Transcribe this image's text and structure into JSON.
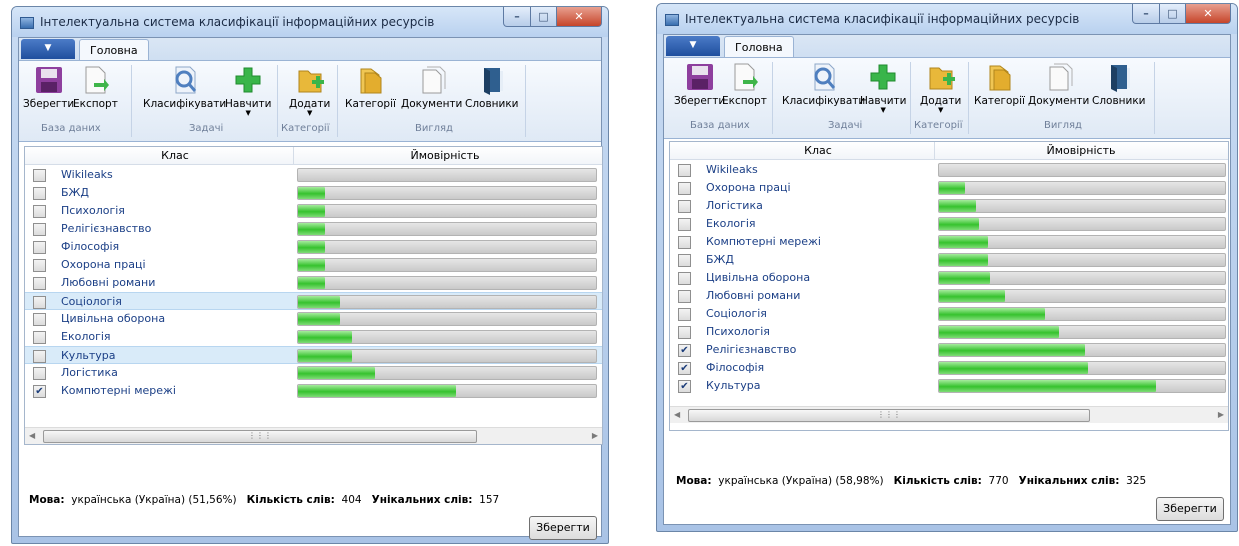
{
  "windows": [
    {
      "title": "Інтелектуальна система класифікації інформаційних ресурсів",
      "tab_home": "Головна",
      "ribbon": {
        "save": "Зберегти",
        "export": "Експорт",
        "classify": "Класифікувати",
        "train": "Навчити",
        "add": "Додати",
        "categories": "Категорії",
        "documents": "Документи",
        "dictionaries": "Словники",
        "group_db": "База даних",
        "group_tasks": "Задачі",
        "group_categories": "Категорії",
        "group_view": "Вигляд"
      },
      "grid": {
        "col_class": "Клас",
        "col_prob": "Ймовірність",
        "rows": [
          {
            "label": "Wikileaks",
            "checked": false,
            "prob": 0.0
          },
          {
            "label": "БЖД",
            "checked": false,
            "prob": 0.09
          },
          {
            "label": "Психологія",
            "checked": false,
            "prob": 0.09
          },
          {
            "label": "Релігієзнавство",
            "checked": false,
            "prob": 0.09
          },
          {
            "label": "Філософія",
            "checked": false,
            "prob": 0.09
          },
          {
            "label": "Охорона праці",
            "checked": false,
            "prob": 0.09
          },
          {
            "label": "Любовні романи",
            "checked": false,
            "prob": 0.09
          },
          {
            "label": "Соціологія",
            "checked": false,
            "prob": 0.14,
            "selected": true
          },
          {
            "label": "Цивільна оборона",
            "checked": false,
            "prob": 0.14
          },
          {
            "label": "Екологія",
            "checked": false,
            "prob": 0.18
          },
          {
            "label": "Культура",
            "checked": false,
            "prob": 0.18,
            "selected": true
          },
          {
            "label": "Логістика",
            "checked": false,
            "prob": 0.26
          },
          {
            "label": "Компютерні мережі",
            "checked": true,
            "prob": 0.53
          }
        ]
      },
      "status": {
        "lang_label": "Мова:",
        "lang_value": "українська (Україна) (51,56%)",
        "words_label": "Кількість слів:",
        "words_value": "404",
        "unique_label": "Унікальних слів:",
        "unique_value": "157"
      },
      "save_button": "Зберегти"
    },
    {
      "title": "Інтелектуальна система класифікації інформаційних ресурсів",
      "tab_home": "Головна",
      "ribbon": {
        "save": "Зберегти",
        "export": "Експорт",
        "classify": "Класифікувати",
        "train": "Навчити",
        "add": "Додати",
        "categories": "Категорії",
        "documents": "Документи",
        "dictionaries": "Словники",
        "group_db": "База даних",
        "group_tasks": "Задачі",
        "group_categories": "Категорії",
        "group_view": "Вигляд"
      },
      "grid": {
        "col_class": "Клас",
        "col_prob": "Ймовірність",
        "rows": [
          {
            "label": "Wikileaks",
            "checked": false,
            "prob": 0.0
          },
          {
            "label": "Охорона праці",
            "checked": false,
            "prob": 0.09
          },
          {
            "label": "Логістика",
            "checked": false,
            "prob": 0.13
          },
          {
            "label": "Екологія",
            "checked": false,
            "prob": 0.14
          },
          {
            "label": "Компютерні мережі",
            "checked": false,
            "prob": 0.17
          },
          {
            "label": "БЖД",
            "checked": false,
            "prob": 0.17
          },
          {
            "label": "Цивільна оборона",
            "checked": false,
            "prob": 0.18
          },
          {
            "label": "Любовні романи",
            "checked": false,
            "prob": 0.23
          },
          {
            "label": "Соціологія",
            "checked": false,
            "prob": 0.37
          },
          {
            "label": "Психологія",
            "checked": false,
            "prob": 0.42
          },
          {
            "label": "Релігієзнавство",
            "checked": true,
            "prob": 0.51
          },
          {
            "label": "Філософія",
            "checked": true,
            "prob": 0.52
          },
          {
            "label": "Культура",
            "checked": true,
            "prob": 0.76
          }
        ]
      },
      "status": {
        "lang_label": "Мова:",
        "lang_value": "українська (Україна) (58,98%)",
        "words_label": "Кількість слів:",
        "words_value": "770",
        "unique_label": "Унікальних слів:",
        "unique_value": "325"
      },
      "save_button": "Зберегти"
    }
  ]
}
